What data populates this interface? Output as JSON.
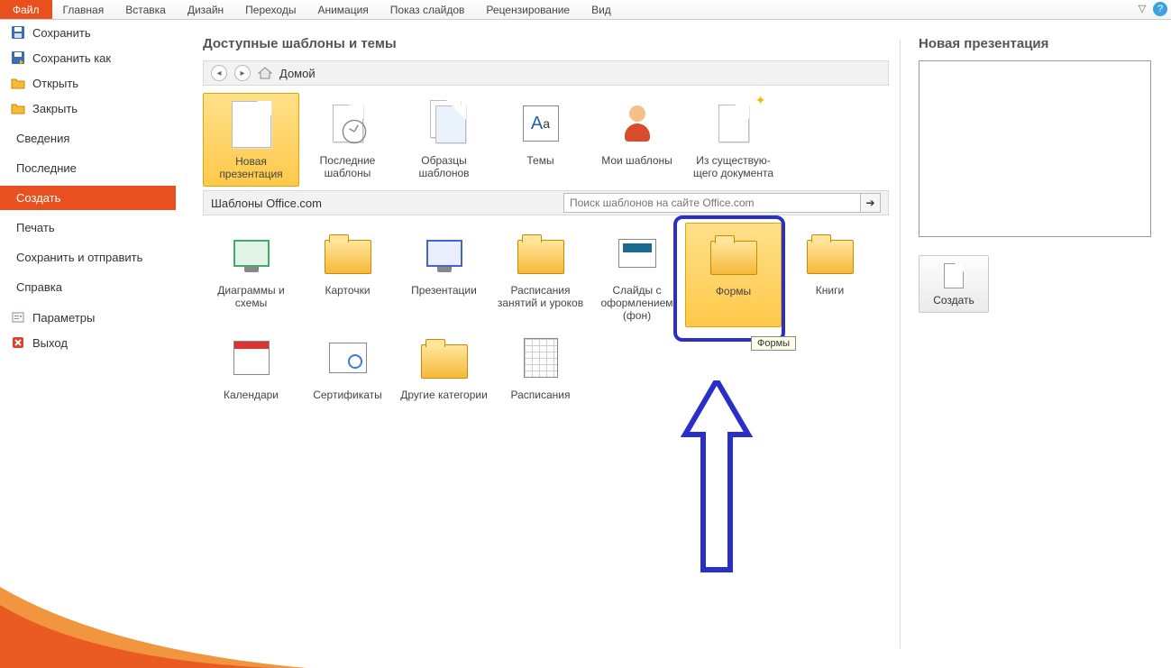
{
  "ribbon": {
    "file": "Файл",
    "tabs": [
      "Главная",
      "Вставка",
      "Дизайн",
      "Переходы",
      "Анимация",
      "Показ слайдов",
      "Рецензирование",
      "Вид"
    ],
    "help": "?"
  },
  "leftMenu": {
    "items": [
      {
        "label": "Сохранить",
        "icon": "save"
      },
      {
        "label": "Сохранить как",
        "icon": "saveas"
      },
      {
        "label": "Открыть",
        "icon": "open"
      },
      {
        "label": "Закрыть",
        "icon": "close"
      },
      {
        "label": "Сведения",
        "icon": ""
      },
      {
        "label": "Последние",
        "icon": ""
      },
      {
        "label": "Создать",
        "icon": "",
        "active": true
      },
      {
        "label": "Печать",
        "icon": ""
      },
      {
        "label": "Сохранить и отправить",
        "icon": ""
      },
      {
        "label": "Справка",
        "icon": ""
      },
      {
        "label": "Параметры",
        "icon": "options"
      },
      {
        "label": "Выход",
        "icon": "exit"
      }
    ]
  },
  "center": {
    "title": "Доступные шаблоны и темы",
    "home": "Домой",
    "row1": [
      {
        "label": "Новая презентация",
        "type": "doc",
        "selected": true
      },
      {
        "label": "Последние шаблоны",
        "type": "clockdoc"
      },
      {
        "label": "Образцы шаблонов",
        "type": "docstack"
      },
      {
        "label": "Темы",
        "type": "theme"
      },
      {
        "label": "Мои шаблоны",
        "type": "user"
      },
      {
        "label": "Из существую-щего документа",
        "type": "stardoc"
      }
    ],
    "officeBar": "Шаблоны Office.com",
    "searchPlaceholder": "Поиск шаблонов на сайте Office.com",
    "row2": [
      {
        "label": "Диаграммы и схемы",
        "type": "screen"
      },
      {
        "label": "Карточки",
        "type": "folder"
      },
      {
        "label": "Презентации",
        "type": "screen"
      },
      {
        "label": "Расписания занятий и уроков",
        "type": "folder"
      },
      {
        "label": "Слайды с оформлением (фон)",
        "type": "slide"
      },
      {
        "label": "Формы",
        "type": "folder",
        "highlighted": true
      },
      {
        "label": "Книги",
        "type": "folder"
      }
    ],
    "row3": [
      {
        "label": "Календари",
        "type": "cal"
      },
      {
        "label": "Сертификаты",
        "type": "cert"
      },
      {
        "label": "Другие категории",
        "type": "folder"
      },
      {
        "label": "Расписания",
        "type": "grid"
      }
    ],
    "tooltip": "Формы"
  },
  "right": {
    "title": "Новая презентация",
    "create": "Создать"
  }
}
